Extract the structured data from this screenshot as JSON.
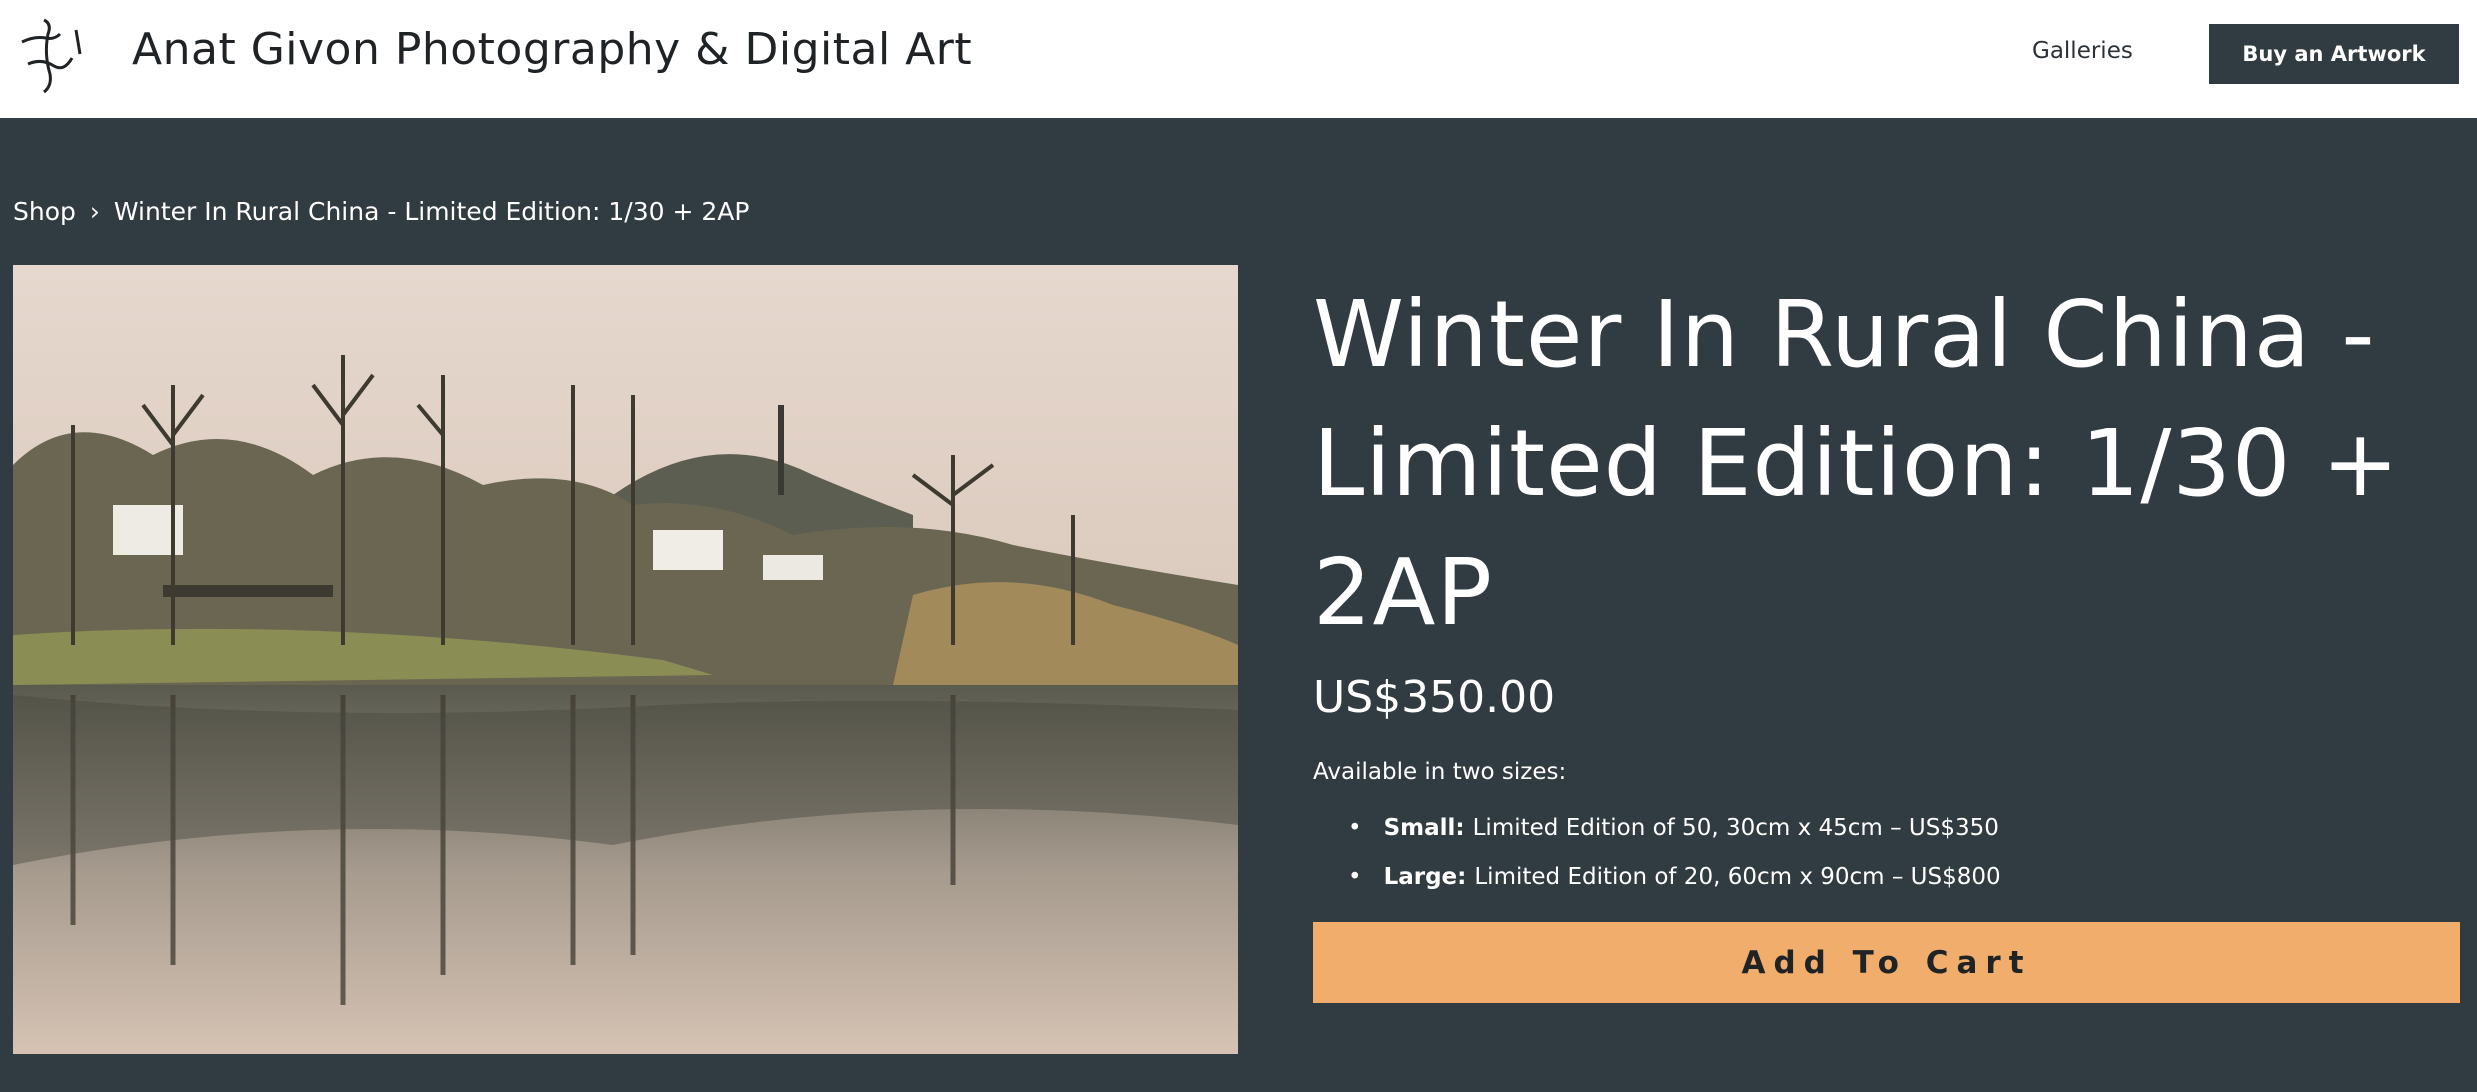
{
  "header": {
    "site_title": "Anat Givon Photography & Digital Art",
    "nav_galleries": "Galleries",
    "nav_buy": "Buy an Artwork"
  },
  "breadcrumb": {
    "shop": "Shop",
    "separator": "›",
    "current": "Winter In Rural China - Limited Edition: 1/30 + 2AP"
  },
  "product": {
    "title": "Winter In Rural China - Limited Edition: 1/30 + 2AP",
    "price": "US$350.00",
    "availability": "Available in two sizes:",
    "sizes": [
      {
        "name": "Small:",
        "detail": "Limited Edition of 50, 30cm x 45cm – US$350"
      },
      {
        "name": "Large:",
        "detail": "Limited Edition of 20, 60cm x 90cm – US$800"
      }
    ],
    "add_to_cart": "Add To Cart"
  },
  "colors": {
    "background": "#313b42",
    "header_bg": "#ffffff",
    "button_accent": "#f0ad6b"
  }
}
